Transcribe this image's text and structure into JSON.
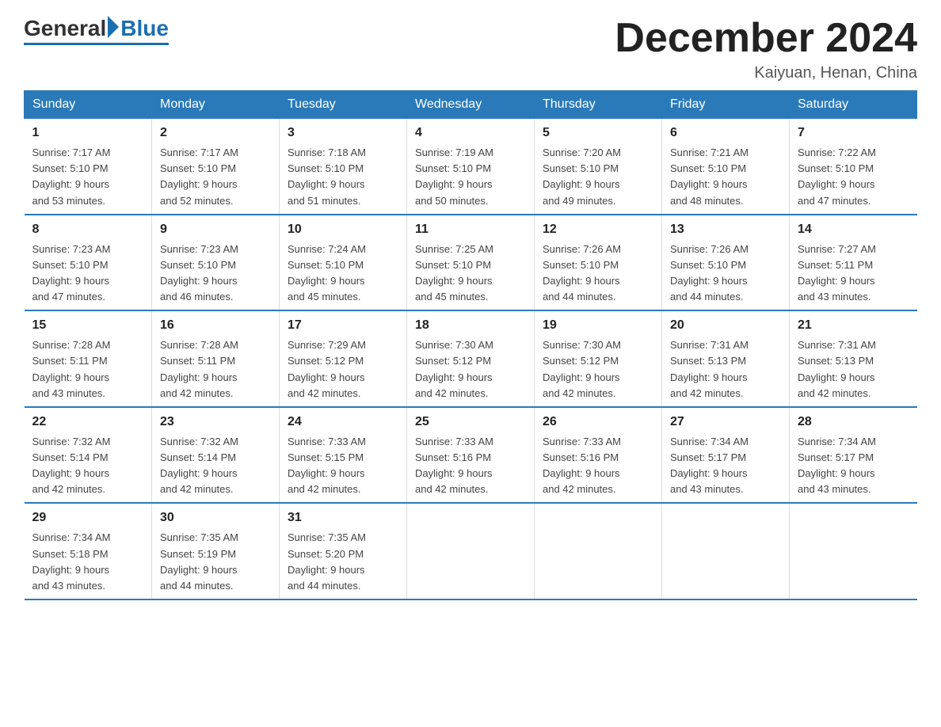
{
  "logo": {
    "general": "General",
    "blue": "Blue"
  },
  "title": "December 2024",
  "location": "Kaiyuan, Henan, China",
  "weekdays": [
    "Sunday",
    "Monday",
    "Tuesday",
    "Wednesday",
    "Thursday",
    "Friday",
    "Saturday"
  ],
  "weeks": [
    [
      {
        "day": "1",
        "sunrise": "7:17 AM",
        "sunset": "5:10 PM",
        "daylight": "9 hours and 53 minutes."
      },
      {
        "day": "2",
        "sunrise": "7:17 AM",
        "sunset": "5:10 PM",
        "daylight": "9 hours and 52 minutes."
      },
      {
        "day": "3",
        "sunrise": "7:18 AM",
        "sunset": "5:10 PM",
        "daylight": "9 hours and 51 minutes."
      },
      {
        "day": "4",
        "sunrise": "7:19 AM",
        "sunset": "5:10 PM",
        "daylight": "9 hours and 50 minutes."
      },
      {
        "day": "5",
        "sunrise": "7:20 AM",
        "sunset": "5:10 PM",
        "daylight": "9 hours and 49 minutes."
      },
      {
        "day": "6",
        "sunrise": "7:21 AM",
        "sunset": "5:10 PM",
        "daylight": "9 hours and 48 minutes."
      },
      {
        "day": "7",
        "sunrise": "7:22 AM",
        "sunset": "5:10 PM",
        "daylight": "9 hours and 47 minutes."
      }
    ],
    [
      {
        "day": "8",
        "sunrise": "7:23 AM",
        "sunset": "5:10 PM",
        "daylight": "9 hours and 47 minutes."
      },
      {
        "day": "9",
        "sunrise": "7:23 AM",
        "sunset": "5:10 PM",
        "daylight": "9 hours and 46 minutes."
      },
      {
        "day": "10",
        "sunrise": "7:24 AM",
        "sunset": "5:10 PM",
        "daylight": "9 hours and 45 minutes."
      },
      {
        "day": "11",
        "sunrise": "7:25 AM",
        "sunset": "5:10 PM",
        "daylight": "9 hours and 45 minutes."
      },
      {
        "day": "12",
        "sunrise": "7:26 AM",
        "sunset": "5:10 PM",
        "daylight": "9 hours and 44 minutes."
      },
      {
        "day": "13",
        "sunrise": "7:26 AM",
        "sunset": "5:10 PM",
        "daylight": "9 hours and 44 minutes."
      },
      {
        "day": "14",
        "sunrise": "7:27 AM",
        "sunset": "5:11 PM",
        "daylight": "9 hours and 43 minutes."
      }
    ],
    [
      {
        "day": "15",
        "sunrise": "7:28 AM",
        "sunset": "5:11 PM",
        "daylight": "9 hours and 43 minutes."
      },
      {
        "day": "16",
        "sunrise": "7:28 AM",
        "sunset": "5:11 PM",
        "daylight": "9 hours and 42 minutes."
      },
      {
        "day": "17",
        "sunrise": "7:29 AM",
        "sunset": "5:12 PM",
        "daylight": "9 hours and 42 minutes."
      },
      {
        "day": "18",
        "sunrise": "7:30 AM",
        "sunset": "5:12 PM",
        "daylight": "9 hours and 42 minutes."
      },
      {
        "day": "19",
        "sunrise": "7:30 AM",
        "sunset": "5:12 PM",
        "daylight": "9 hours and 42 minutes."
      },
      {
        "day": "20",
        "sunrise": "7:31 AM",
        "sunset": "5:13 PM",
        "daylight": "9 hours and 42 minutes."
      },
      {
        "day": "21",
        "sunrise": "7:31 AM",
        "sunset": "5:13 PM",
        "daylight": "9 hours and 42 minutes."
      }
    ],
    [
      {
        "day": "22",
        "sunrise": "7:32 AM",
        "sunset": "5:14 PM",
        "daylight": "9 hours and 42 minutes."
      },
      {
        "day": "23",
        "sunrise": "7:32 AM",
        "sunset": "5:14 PM",
        "daylight": "9 hours and 42 minutes."
      },
      {
        "day": "24",
        "sunrise": "7:33 AM",
        "sunset": "5:15 PM",
        "daylight": "9 hours and 42 minutes."
      },
      {
        "day": "25",
        "sunrise": "7:33 AM",
        "sunset": "5:16 PM",
        "daylight": "9 hours and 42 minutes."
      },
      {
        "day": "26",
        "sunrise": "7:33 AM",
        "sunset": "5:16 PM",
        "daylight": "9 hours and 42 minutes."
      },
      {
        "day": "27",
        "sunrise": "7:34 AM",
        "sunset": "5:17 PM",
        "daylight": "9 hours and 43 minutes."
      },
      {
        "day": "28",
        "sunrise": "7:34 AM",
        "sunset": "5:17 PM",
        "daylight": "9 hours and 43 minutes."
      }
    ],
    [
      {
        "day": "29",
        "sunrise": "7:34 AM",
        "sunset": "5:18 PM",
        "daylight": "9 hours and 43 minutes."
      },
      {
        "day": "30",
        "sunrise": "7:35 AM",
        "sunset": "5:19 PM",
        "daylight": "9 hours and 44 minutes."
      },
      {
        "day": "31",
        "sunrise": "7:35 AM",
        "sunset": "5:20 PM",
        "daylight": "9 hours and 44 minutes."
      },
      null,
      null,
      null,
      null
    ]
  ],
  "labels": {
    "sunrise": "Sunrise:",
    "sunset": "Sunset:",
    "daylight": "Daylight:"
  }
}
